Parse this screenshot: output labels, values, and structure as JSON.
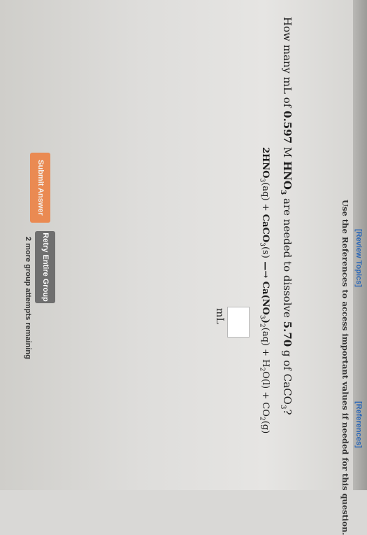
{
  "header": {
    "review_topics": "[Review Topics]",
    "references": "[References]",
    "instruction": "Use the References to access important values if needed for this question."
  },
  "question": {
    "prefix": "How many mL of ",
    "concentration": "0.597",
    "conc_unit": " M ",
    "acid_formula": "HNO",
    "acid_sub": "3",
    "middle": " are needed to dissolve ",
    "mass": "5.70",
    "mass_unit": " g",
    "of": " of CaCO",
    "caco3_sub": "3",
    "end": "?"
  },
  "equation": {
    "lhs1": "2HNO",
    "lhs1_sub": "3",
    "lhs1_state": "(aq) + ",
    "lhs2": "CaCO",
    "lhs2_sub": "3",
    "lhs2_state": "(s)",
    "arrow": " —→ ",
    "rhs1": "Ca(NO",
    "rhs1_sub": "3",
    "rhs1_end": ")",
    "rhs1_sub2": "2",
    "rhs1_state": "(aq) + H",
    "rhs2_sub": "2",
    "rhs2_state": "O(l) + CO",
    "rhs3_sub": "2",
    "rhs3_state": "(g)"
  },
  "answer": {
    "value": "",
    "unit": "mL"
  },
  "buttons": {
    "submit": "Submit Answer",
    "retry": "Retry Entire Group"
  },
  "status": {
    "remaining": "2 more group attempts remaining"
  }
}
